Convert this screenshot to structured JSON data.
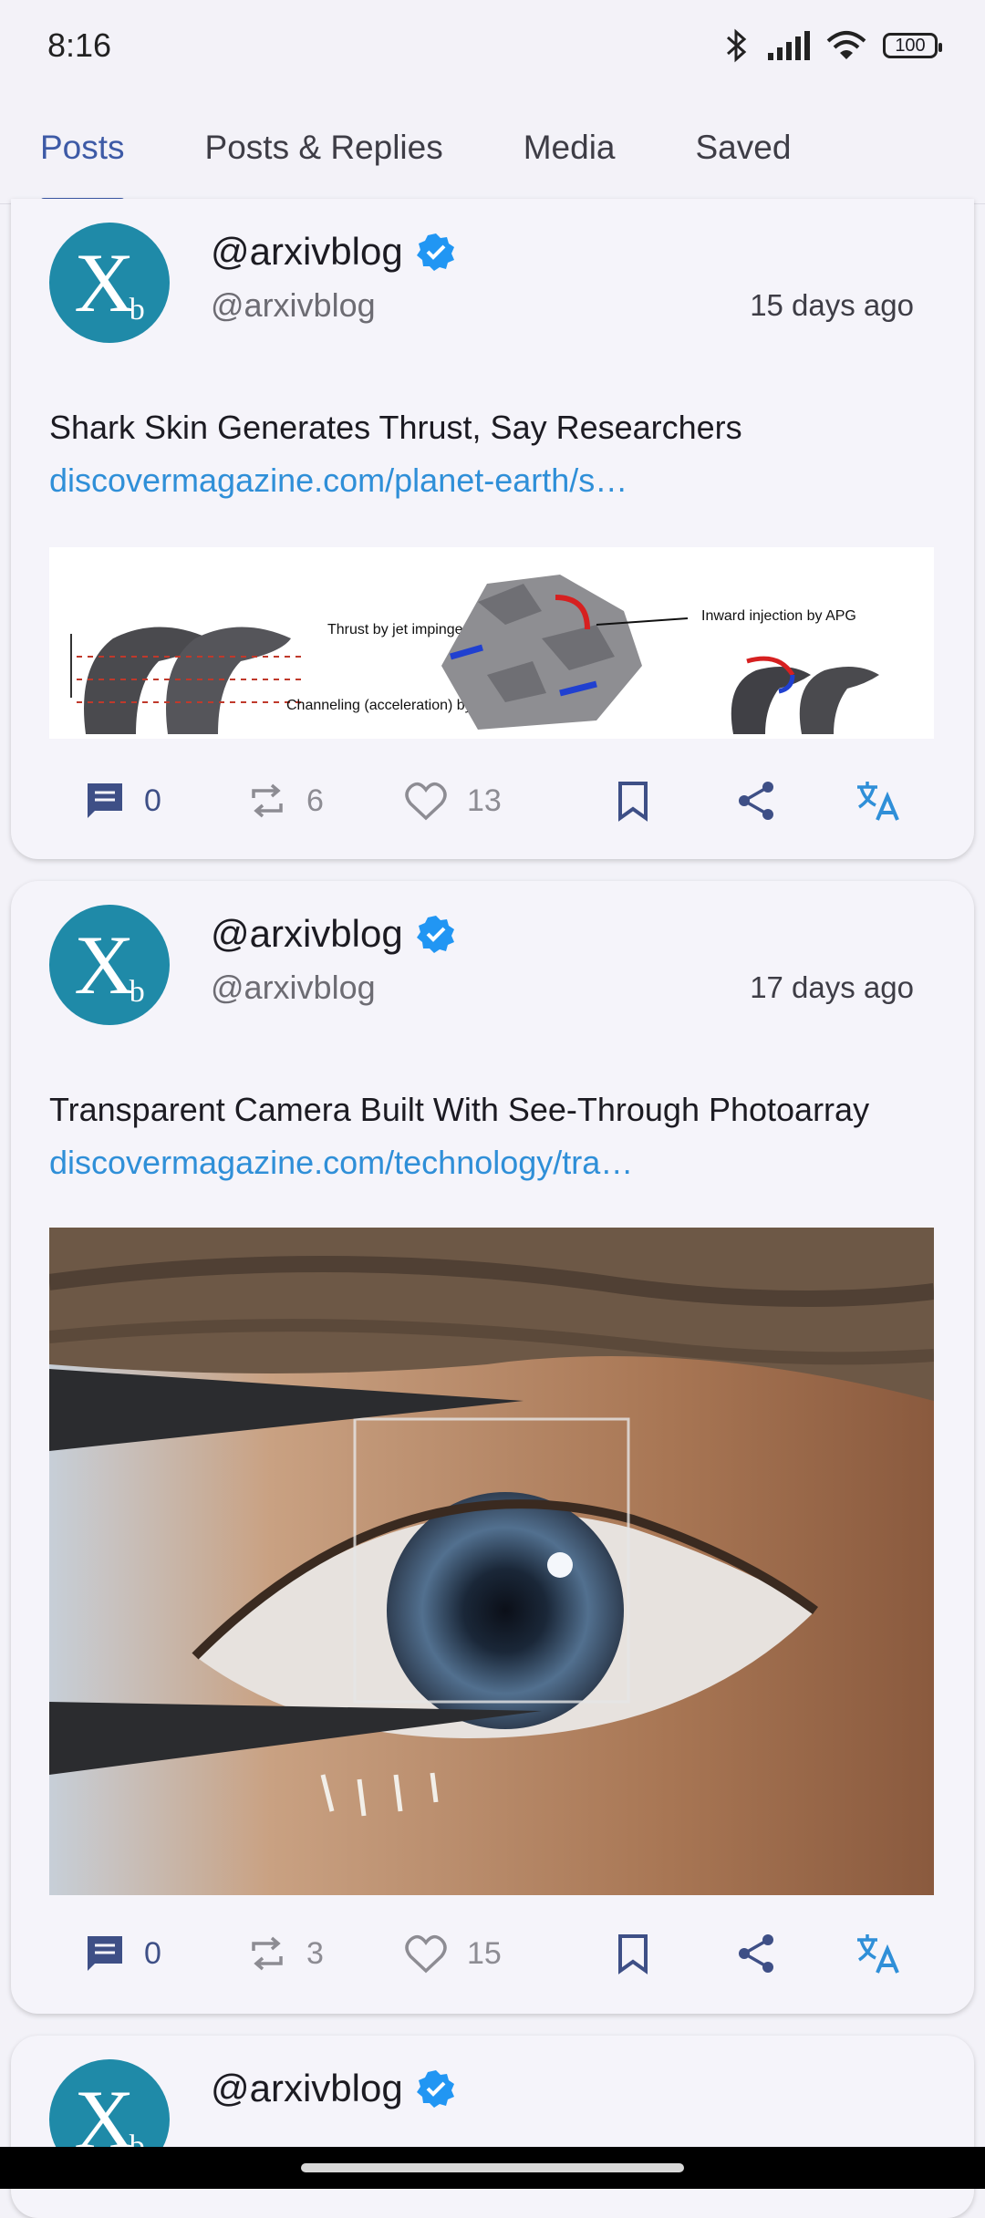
{
  "status_bar": {
    "time": "8:16",
    "battery": "100"
  },
  "tabs": [
    {
      "label": "Posts",
      "active": true
    },
    {
      "label": "Posts & Replies",
      "active": false
    },
    {
      "label": "Media",
      "active": false
    },
    {
      "label": "Saved",
      "active": false
    }
  ],
  "posts": [
    {
      "display_name": "@arxivblog",
      "handle": "@arxivblog",
      "time_ago": "15 days ago",
      "text": "Shark Skin Generates Thrust, Say Researchers",
      "link": "discovermagazine.com/planet-earth/s…",
      "media_labels": {
        "label1": "Thrust by jet impingement & shear",
        "label2": "Channeling (acceleration) by staggered necks",
        "label3": "Inward injection by APG"
      },
      "replies": "0",
      "reposts": "6",
      "likes": "13"
    },
    {
      "display_name": "@arxivblog",
      "handle": "@arxivblog",
      "time_ago": "17 days ago",
      "text": "Transparent Camera Built With See-Through Photoarray",
      "link": "discovermagazine.com/technology/tra…",
      "replies": "0",
      "reposts": "3",
      "likes": "15"
    },
    {
      "display_name": "@arxivblog"
    }
  ],
  "colors": {
    "accent": "#3d5aa6",
    "link": "#2f8fd8",
    "avatar": "#1f8aa8",
    "verified": "#2196f3"
  },
  "icons": {
    "reply": "comment-icon",
    "repost": "repost-icon",
    "like": "heart-icon",
    "bookmark": "bookmark-icon",
    "share": "share-icon",
    "translate": "translate-icon"
  }
}
